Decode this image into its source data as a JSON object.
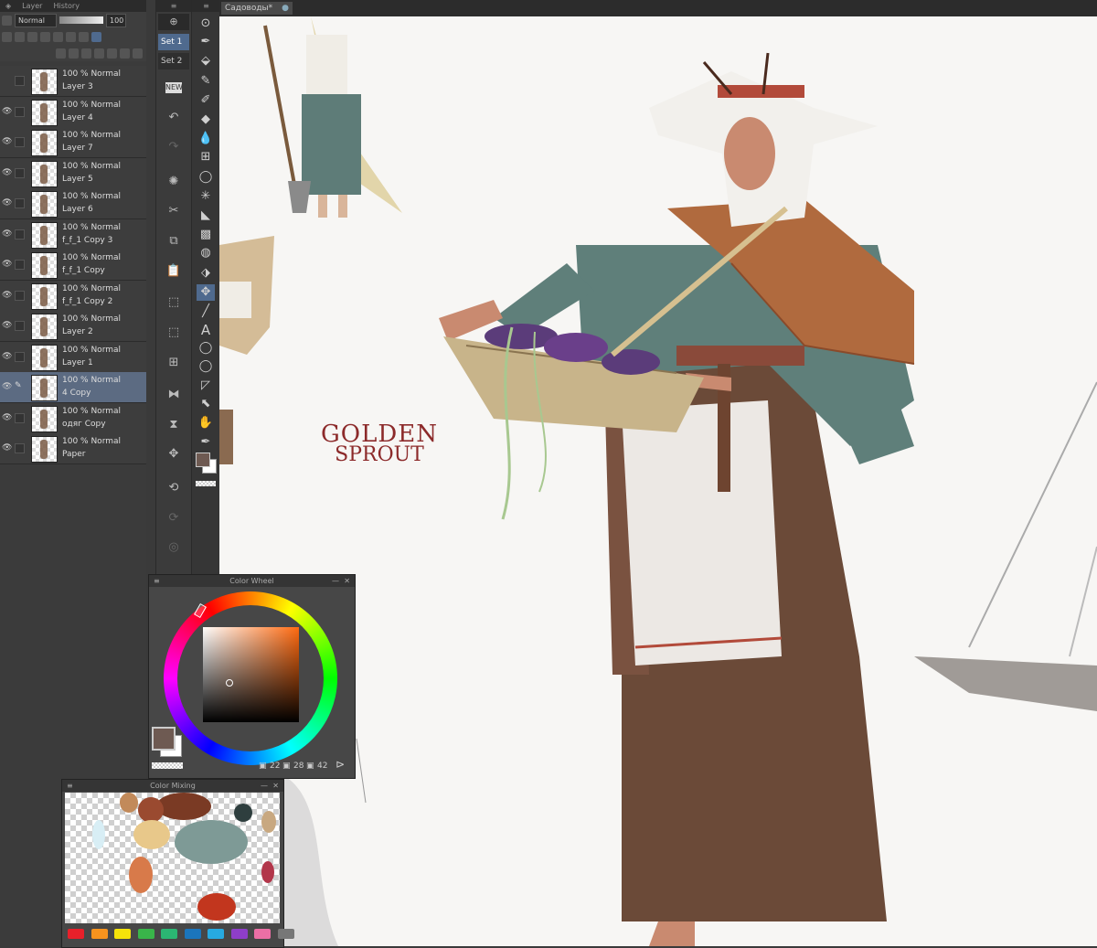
{
  "document_tab": {
    "title": "Садоводы*"
  },
  "layer_panel": {
    "tabs": [
      "Layer",
      "History"
    ],
    "blend_mode": "Normal",
    "opacity": "100",
    "layers": [
      {
        "mode": "100 % Normal",
        "name": "Layer 3",
        "visible": false,
        "selected": false
      },
      {
        "mode": "100 % Normal",
        "name": "Layer 4",
        "visible": true,
        "selected": false
      },
      {
        "mode": "100 % Normal",
        "name": "Layer 7",
        "visible": true,
        "selected": false
      },
      {
        "mode": "100 % Normal",
        "name": "Layer 5",
        "visible": true,
        "selected": false
      },
      {
        "mode": "100 % Normal",
        "name": "Layer 6",
        "visible": true,
        "selected": false
      },
      {
        "mode": "100 % Normal",
        "name": "f_f_1 Copy 3",
        "visible": true,
        "selected": false
      },
      {
        "mode": "100 % Normal",
        "name": "f_f_1 Copy",
        "visible": true,
        "selected": false
      },
      {
        "mode": "100 % Normal",
        "name": "f_f_1 Copy 2",
        "visible": true,
        "selected": false
      },
      {
        "mode": "100 % Normal",
        "name": "Layer 2",
        "visible": true,
        "selected": false
      },
      {
        "mode": "100 % Normal",
        "name": "Layer 1",
        "visible": true,
        "selected": false
      },
      {
        "mode": "100 % Normal",
        "name": "4 Copy",
        "visible": true,
        "selected": true
      },
      {
        "mode": "100 % Normal",
        "name": "одяг Copy",
        "visible": true,
        "selected": false
      },
      {
        "mode": "100 % Normal",
        "name": "Paper",
        "visible": true,
        "selected": false
      }
    ]
  },
  "sets": [
    "Set 1",
    "Set 2"
  ],
  "color_wheel": {
    "title": "Color Wheel",
    "main_color": "#6e5a52",
    "sub_color": "#ffffff",
    "h": "22",
    "s": "28",
    "v": "42"
  },
  "color_mixing": {
    "title": "Color Mixing",
    "palette": [
      "#e8202a",
      "#f7931e",
      "#f5e30a",
      "#39b54a",
      "#2bb673",
      "#1b75bc",
      "#27aae1",
      "#8e3ec9",
      "#ec6fa5",
      "#777777"
    ]
  },
  "canvas": {
    "logo_line1": "GOLDEN",
    "logo_line2": "SPROUT"
  }
}
